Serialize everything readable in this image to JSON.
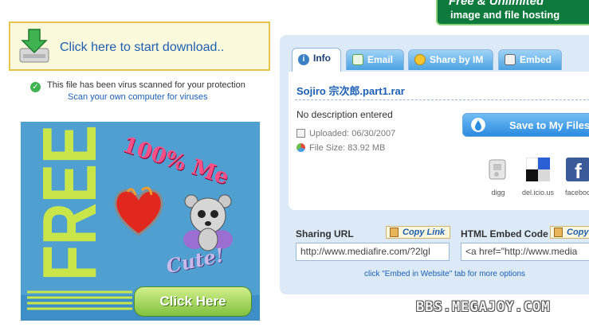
{
  "download": {
    "label": "Click here to start download..",
    "icon": "download-arrow-icon"
  },
  "virus_scan": {
    "message": "This file has been virus scanned for your protection",
    "scan_link": "Scan your own computer for viruses"
  },
  "ad": {
    "free_text": "FREE",
    "headline": "100% Me",
    "cute_text": "Cute!",
    "button_label": "Click Here",
    "colors": {
      "background": "#4f9fd0",
      "free": "#c8e64a",
      "headline": "#ff4f86"
    }
  },
  "banner": {
    "line1": "Free & Unlimited",
    "line2": "image and file hosting",
    "color": "#0f7a3d"
  },
  "tabs": [
    {
      "label": "Info",
      "icon": "info-icon",
      "active": true
    },
    {
      "label": "Email",
      "icon": "email-icon",
      "active": false
    },
    {
      "label": "Share by IM",
      "icon": "im-icon",
      "active": false
    },
    {
      "label": "Embed",
      "icon": "embed-icon",
      "active": false
    }
  ],
  "file": {
    "name": "Sojiro 宗次郎.part1.rar",
    "description": "No description entered",
    "uploaded": "Uploaded: 06/30/2007",
    "size": "File Size: 83.92 MB"
  },
  "save_button": "Save to My Files",
  "share_sites": [
    {
      "label": "digg",
      "icon": "digg-icon"
    },
    {
      "label": "del.icio.us",
      "icon": "delicious-icon"
    },
    {
      "label": "faceboo",
      "icon": "facebook-icon"
    }
  ],
  "sharing": {
    "url_label": "Sharing URL",
    "url_copy": "Copy Link",
    "url_value": "http://www.mediafire.com/?2lgl",
    "embed_label": "HTML Embed Code",
    "embed_copy": "Copy",
    "embed_value": "<a href=\"http://www.media",
    "hint": "click \"Embed in Website\" tab for more options"
  },
  "watermark": "BBS.MEGAJOY.COM",
  "colors": {
    "link": "#1c5fb5",
    "panel": "#dce9f7",
    "tab": "#4aa2e1"
  }
}
